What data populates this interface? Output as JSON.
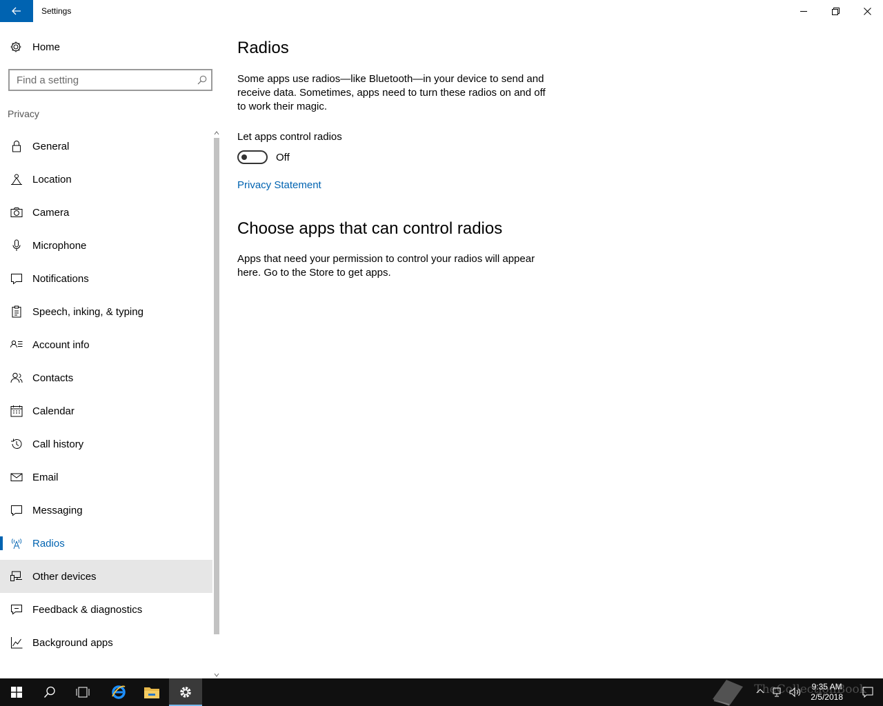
{
  "window": {
    "title": "Settings"
  },
  "sidebar": {
    "home_label": "Home",
    "search_placeholder": "Find a setting",
    "section_label": "Privacy",
    "items": [
      {
        "label": "General",
        "icon": "lock-icon"
      },
      {
        "label": "Location",
        "icon": "location-icon"
      },
      {
        "label": "Camera",
        "icon": "camera-icon"
      },
      {
        "label": "Microphone",
        "icon": "microphone-icon"
      },
      {
        "label": "Notifications",
        "icon": "notifications-icon"
      },
      {
        "label": "Speech, inking, & typing",
        "icon": "clipboard-icon"
      },
      {
        "label": "Account info",
        "icon": "account-info-icon"
      },
      {
        "label": "Contacts",
        "icon": "contacts-icon"
      },
      {
        "label": "Calendar",
        "icon": "calendar-icon"
      },
      {
        "label": "Call history",
        "icon": "history-icon"
      },
      {
        "label": "Email",
        "icon": "email-icon"
      },
      {
        "label": "Messaging",
        "icon": "messaging-icon"
      },
      {
        "label": "Radios",
        "icon": "radio-tower-icon",
        "selected": true
      },
      {
        "label": "Other devices",
        "icon": "devices-icon",
        "hover": true
      },
      {
        "label": "Feedback & diagnostics",
        "icon": "feedback-icon"
      },
      {
        "label": "Background apps",
        "icon": "background-apps-icon"
      }
    ]
  },
  "main": {
    "title": "Radios",
    "description": "Some apps use radios—like Bluetooth—in your device to send and receive data. Sometimes, apps need to turn these radios on and off to work their magic.",
    "toggle_label": "Let apps control radios",
    "toggle_state": "Off",
    "privacy_link": "Privacy Statement",
    "section_title": "Choose apps that can control radios",
    "section_description": "Apps that need your permission to control your radios will appear here. Go to the Store to get apps."
  },
  "taskbar": {
    "time": "9:35 AM",
    "date": "2/5/2018",
    "watermark": "TheCollectionBook"
  },
  "colors": {
    "accent": "#0063b1",
    "taskbar": "#101010",
    "hover": "#e6e6e6"
  }
}
